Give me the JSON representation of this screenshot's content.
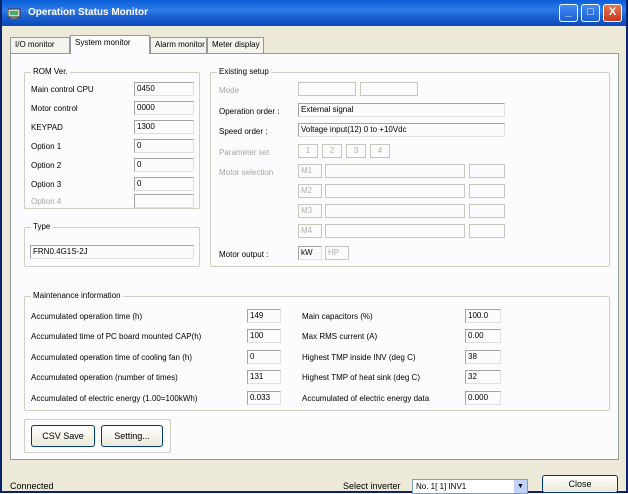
{
  "window": {
    "title": "Operation Status Monitor",
    "controls": {
      "minimize": "_",
      "maximize": "□",
      "close": "X"
    },
    "accent_color": "#0a5fd8"
  },
  "tabs": [
    {
      "label": "I/O monitor",
      "active": false
    },
    {
      "label": "System monitor",
      "active": true
    },
    {
      "label": "Alarm monitor",
      "active": false
    },
    {
      "label": "Meter display",
      "active": false
    }
  ],
  "rom": {
    "legend": "ROM Ver.",
    "rows": [
      {
        "label": "Main control CPU",
        "value": "0450"
      },
      {
        "label": "Motor control",
        "value": "0000"
      },
      {
        "label": "KEYPAD",
        "value": "1300"
      },
      {
        "label": "Option 1",
        "value": "0"
      },
      {
        "label": "Option 2",
        "value": "0"
      },
      {
        "label": "Option 3",
        "value": "0"
      },
      {
        "label": "Option 4",
        "value": ""
      }
    ]
  },
  "type": {
    "legend": "Type",
    "value": "FRN0.4G1S-2J"
  },
  "setup": {
    "legend": "Existing setup",
    "mode_label": "Mode",
    "operation_order_label": "Operation order :",
    "operation_order_value": "External signal",
    "speed_order_label": "Speed order :",
    "speed_order_value": "Voltage input(12) 0 to +10Vdc",
    "parameter_set_label": "Parameter set",
    "parameter_set_buttons": [
      "1",
      "2",
      "3",
      "4"
    ],
    "motor_selection_label": "Motor selection",
    "motors": [
      "M1",
      "M2",
      "M3",
      "M4"
    ],
    "motor_output_label": "Motor output :",
    "motor_output_units": [
      "kW",
      "HP"
    ]
  },
  "maintenance": {
    "legend": "Maintenance information",
    "left": [
      {
        "label": "Accumulated operation time (h)",
        "value": "149"
      },
      {
        "label": "Accumulated time of PC board mounted CAP(h)",
        "value": "100"
      },
      {
        "label": "Accumulated operation time of cooling fan (h)",
        "value": "0"
      },
      {
        "label": "Accumulated operation (number of times)",
        "value": "131"
      },
      {
        "label": "Accumulated of electric energy (1.00=100kWh)",
        "value": "0.033"
      }
    ],
    "right": [
      {
        "label": "Main capacitors (%)",
        "value": "100.0"
      },
      {
        "label": "Max RMS current (A)",
        "value": "0.00"
      },
      {
        "label": "Highest TMP inside INV (deg C)",
        "value": "38"
      },
      {
        "label": "Highest TMP of heat sink (deg C)",
        "value": "32"
      },
      {
        "label": "Accumulated of electric energy data",
        "value": "0.000"
      }
    ]
  },
  "buttons": {
    "csv_save": "CSV Save",
    "setting": "Setting..."
  },
  "status": {
    "text": "Connected",
    "select_inverter_label": "Select inverter",
    "selected_inverter": "No. 1[ 1] INV1",
    "close_label": "Close"
  }
}
